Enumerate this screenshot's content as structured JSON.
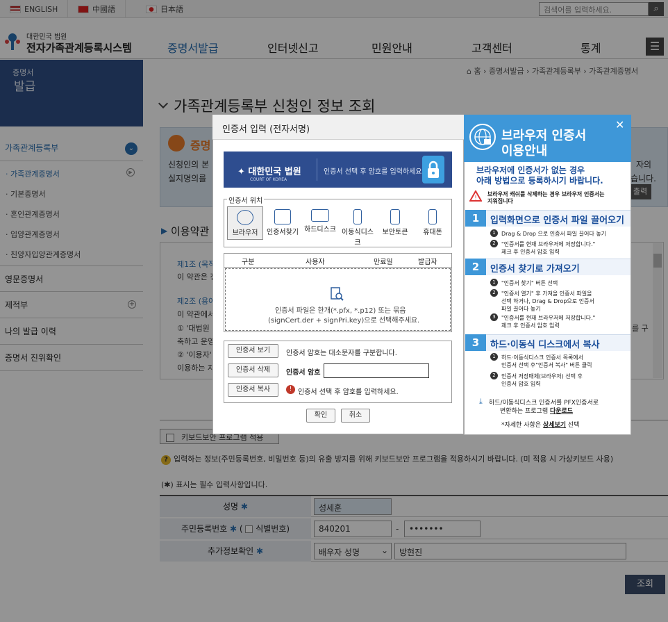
{
  "topbar": {
    "languages": [
      "ENGLISH",
      "中國語",
      "日本語"
    ],
    "search_placeholder": "검색어를 입력하세요."
  },
  "header": {
    "logo_small": "대한민국 법원",
    "logo_main": "전자가족관계등록시스템",
    "nav": [
      "증명서발급",
      "인터넷신고",
      "민원안내",
      "고객센터",
      "통계"
    ]
  },
  "left": {
    "banner": [
      "증명서",
      "발급"
    ],
    "sections": [
      {
        "label": "가족관계등록부"
      },
      {
        "label": "영문증명서"
      },
      {
        "label": "제적부"
      },
      {
        "label": "나의 발급 이력"
      },
      {
        "label": "증명서 진위확인"
      }
    ],
    "subitems": [
      "· 가족관계증명서",
      "· 기본증명서",
      "· 혼인관계증명서",
      "· 입양관계증명서",
      "· 친양자입양관계증명서"
    ]
  },
  "breadcrumb": {
    "home": "홈",
    "items": [
      "증명서발급",
      "가족관계등록부",
      "가족관계증명서"
    ]
  },
  "main": {
    "title": "가족관계등록부 신청인 정보 조회",
    "info_title": "증명",
    "info_line1": "신청인의 본",
    "info_line2": "실지명의를",
    "info_right1": "자의",
    "info_right2": "습니다.",
    "info_button": "출력",
    "terms_title": "이용약관",
    "terms": [
      "제1조 (목적",
      "이 약관은 전",
      "제2조 (용어",
      "이 약관에서",
      "① '대법원",
      "축하고 운영",
      "② '이용자'",
      "이용하는 자"
    ],
    "terms_right": "를 구",
    "keyboard_btn": "키보드보안 프로그램 적용",
    "notice": "입력하는 정보(주민등록번호, 비밀번호 등)의 유출 방지를 위해 키보드보안 프로그램을 적용하시기 바랍니다. (미 적용 시 가상키보드 사용)",
    "required": "(✱) 표시는 필수 입력사항입니다.",
    "form": {
      "name_label": "성명",
      "name_value": "성세훈",
      "rrn_label": "주민등록번호",
      "rrn_sub": "식별번호",
      "rrn_front": "840201",
      "rrn_back": "•••••••",
      "rrn_dash": "-",
      "extra_label": "추가정보확인",
      "extra_select": "배우자 성명",
      "extra_value": "방현진"
    },
    "query_btn": "조회"
  },
  "dialog": {
    "title": "인증서 입력 (전자서명)",
    "banner_logo": "대한민국 법원",
    "banner_logo_sub": "COURT OF KOREA",
    "banner_msg": "인증서 선택 후 암호를 입력하세요.",
    "location_label": "인증서 위치",
    "locations": [
      "브라우저",
      "인증서찾기",
      "하드디스크",
      "이동식디스크",
      "보안토큰",
      "휴대폰"
    ],
    "columns": [
      "구분",
      "사용자",
      "만료일",
      "발급자"
    ],
    "drop_msg1": "인증서 파일은 한개(*.pfx, *.p12) 또는 묶음",
    "drop_msg2": "(signCert.der + signPri.key)으로 선택해주세요.",
    "view_btn": "인증서 보기",
    "view_note": "인증서 암호는 대소문자를 구분합니다.",
    "delete_btn": "인증서 삭제",
    "pw_label": "인증서 암호",
    "copy_btn": "인증서 복사",
    "copy_note": "인증서 선택 후 암호를 입력하세요.",
    "ok": "확인",
    "cancel": "취소"
  },
  "guide": {
    "title1": "브라우저 인증서",
    "title2": "이용안내",
    "sub1": "브라우저에 인증서가 없는 경우",
    "sub2": "아래 방법으로 등록하시기 바랍니다.",
    "warn1": "브라우저 캐쉬를 삭제하는 경우 브라우저 인증서는",
    "warn2": "지워집니다",
    "sections": [
      {
        "num": "1",
        "title": "입력화면으로 인증서 파일 끌어오기",
        "steps": [
          "Drag & Drop 으로 인증서 파일 끌어다 놓기",
          "\"인증서를 현재 브라우저에 저장합니다.\"|체크 후 인증서 암호 입력"
        ]
      },
      {
        "num": "2",
        "title": "인증서 찾기로 가져오기",
        "steps": [
          "\"인증서 찾기\" 버튼 선택",
          "\"인증서 열기\" 후 가져올 인증서 파일을|선택 하거나, Drag & Drop으로 인증서|파일 끌어다 놓기",
          "\"인증서를 현재 브라우저에 저장합니다.\"|체크 후 인증서 암호 입력"
        ]
      },
      {
        "num": "3",
        "title": "하드·이동식 디스크에서 복사",
        "steps": [
          "하드·이동식디스크 인증서 목록에서|인증서 선택 후\"인증서 복사\" 버튼 클릭",
          "인증서 저장매체(브라우저) 선택 후|인증서 암호 입력"
        ]
      }
    ],
    "download1": "하드/이동식디스크 인증서를 PFX인증서로",
    "download2": "변환하는 프로그램 ",
    "download_link": "다운로드",
    "more_prefix": "*자세한 사항은 ",
    "more_link": "상세보기",
    "more_suffix": " 선택"
  },
  "colors": {
    "accent": "#3e97d8",
    "nav_active": "#2a6fb0",
    "left_active": "#2a6fb0"
  }
}
